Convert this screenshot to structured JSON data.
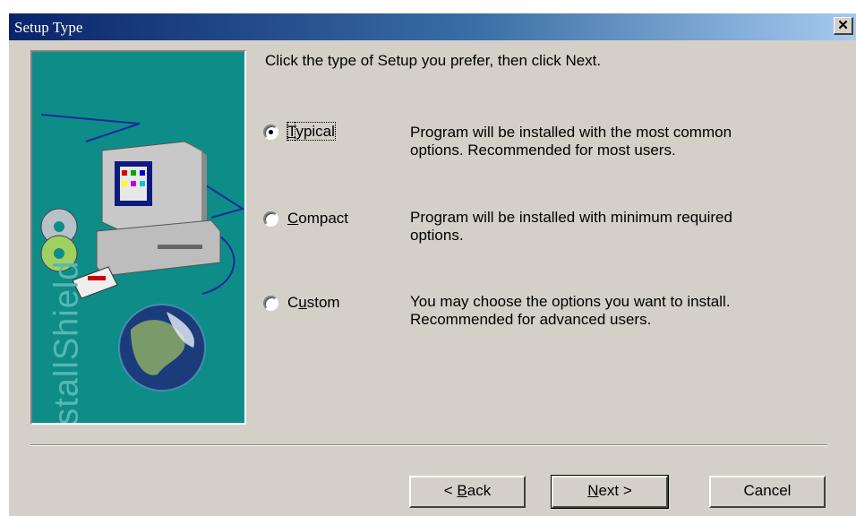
{
  "window": {
    "title": "Setup Type",
    "close_label": "✕"
  },
  "side_panel": {
    "brand_text": "InstallShield"
  },
  "prompt": "Click the type of Setup you prefer, then click Next.",
  "options": [
    {
      "label_pre": "",
      "label_key": "T",
      "label_post": "ypical",
      "description_1": "Program will be installed with the most common",
      "description_2": "options.  Recommended for most users.",
      "selected": true
    },
    {
      "label_pre": "",
      "label_key": "C",
      "label_post": "ompact",
      "description_1": "Program will be installed with minimum required",
      "description_2": "options.",
      "selected": false
    },
    {
      "label_pre": "C",
      "label_key": "u",
      "label_post": "stom",
      "description_1": "You may choose the options you want to install.",
      "description_2": "Recommended for advanced users.",
      "selected": false
    }
  ],
  "buttons": {
    "back_pre": "< ",
    "back_key": "B",
    "back_post": "ack",
    "next_key": "N",
    "next_post": "ext >",
    "cancel": "Cancel"
  }
}
